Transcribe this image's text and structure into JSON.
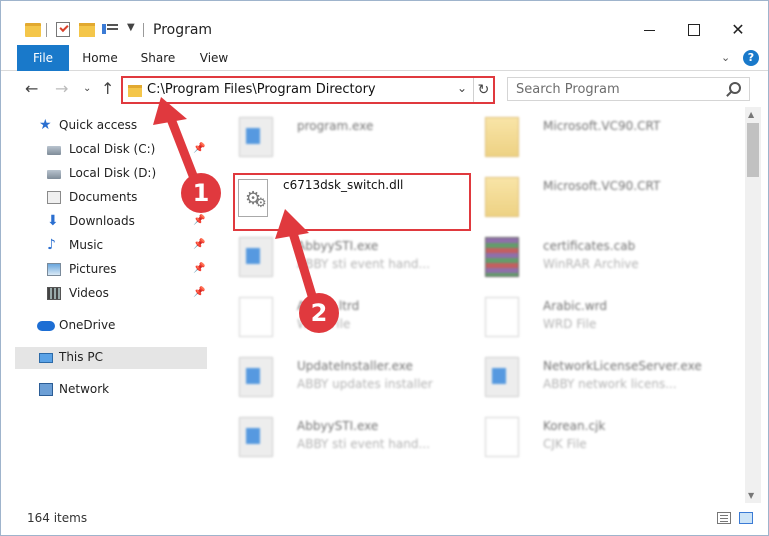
{
  "window": {
    "title": "Program"
  },
  "ribbon": {
    "tabs": [
      "File",
      "Home",
      "Share",
      "View"
    ],
    "help_label": "?"
  },
  "address": {
    "path": "C:\\Program Files\\Program Directory",
    "refresh_icon": "↻"
  },
  "search": {
    "placeholder": "Search Program"
  },
  "nav": {
    "items": [
      {
        "label": "Quick access",
        "icon": "star-icon"
      },
      {
        "label": "Local Disk (C:)",
        "icon": "disk-icon",
        "pinned": true
      },
      {
        "label": "Local Disk (D:)",
        "icon": "disk-icon"
      },
      {
        "label": "Documents",
        "icon": "documents-icon",
        "pinned": true
      },
      {
        "label": "Downloads",
        "icon": "download-icon",
        "pinned": true
      },
      {
        "label": "Music",
        "icon": "music-icon",
        "pinned": true
      },
      {
        "label": "Pictures",
        "icon": "pictures-icon",
        "pinned": true
      },
      {
        "label": "Videos",
        "icon": "videos-icon",
        "pinned": true
      },
      {
        "label": "OneDrive",
        "icon": "cloud-icon"
      },
      {
        "label": "This PC",
        "icon": "computer-icon",
        "selected": true
      },
      {
        "label": "Network",
        "icon": "network-icon"
      }
    ]
  },
  "files": [
    {
      "name": "program.exe",
      "desc": "",
      "icon": "exe-icon"
    },
    {
      "name": "Microsoft.VC90.CRT",
      "desc": "",
      "icon": "folder-icon"
    },
    {
      "name": "c6713dsk_switch.dll",
      "desc": "",
      "icon": "dll-icon",
      "highlighted": true
    },
    {
      "name": "Microsoft.VC90.CRT",
      "desc": "",
      "icon": "folder-icon"
    },
    {
      "name": "AbbyySTI.exe",
      "desc": "ABBY sti event hand...",
      "icon": "exe-icon"
    },
    {
      "name": "certificates.cab",
      "desc": "WinRAR Archive",
      "icon": "archive-icon"
    },
    {
      "name": "Arabic.ltrd",
      "desc": "WRD File",
      "icon": "file-icon"
    },
    {
      "name": "Arabic.wrd",
      "desc": "WRD File",
      "icon": "file-icon"
    },
    {
      "name": "UpdateInstaller.exe",
      "desc": "ABBY updates installer",
      "icon": "exe-icon"
    },
    {
      "name": "NetworkLicenseServer.exe",
      "desc": "ABBY network licens...",
      "icon": "exe-icon"
    },
    {
      "name": "AbbyySTI.exe",
      "desc": "ABBY sti event hand...",
      "icon": "exe-icon"
    },
    {
      "name": "Korean.cjk",
      "desc": "CJK File",
      "icon": "file-icon"
    }
  ],
  "status": {
    "item_count": "164 items"
  },
  "annotations": {
    "badge_1": "1",
    "badge_2": "2",
    "color": "#e0393e"
  }
}
